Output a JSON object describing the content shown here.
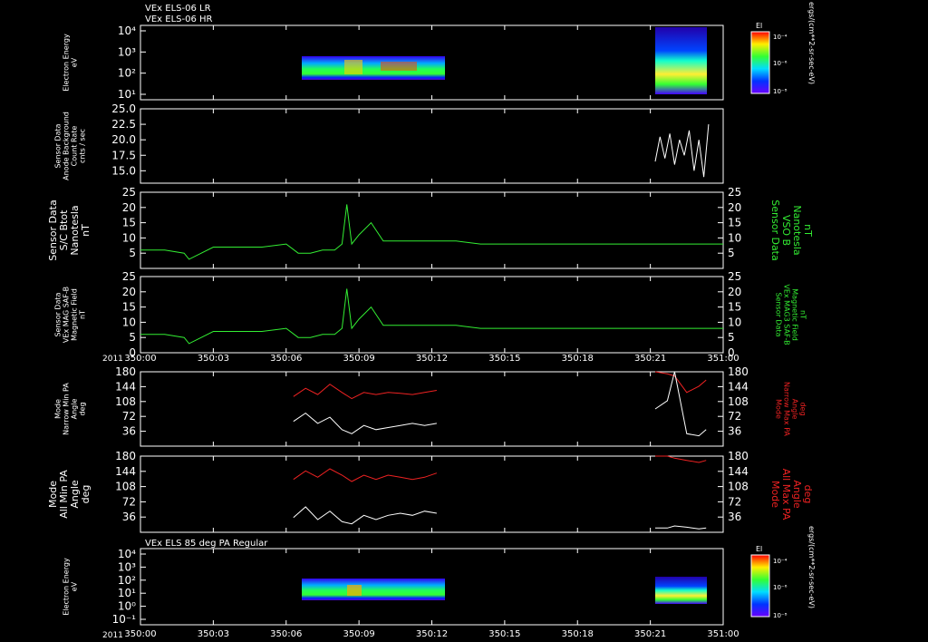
{
  "header": {
    "line1": "VEx ELS-06 LR",
    "line2": "VEx ELS-06 HR"
  },
  "footer_year": "2011",
  "spectrogram2_title": "VEx ELS 85 deg PA Regular",
  "x_ticks": [
    "350:00",
    "350:03",
    "350:06",
    "350:09",
    "350:12",
    "350:15",
    "350:18",
    "350:21",
    "351:00"
  ],
  "colors": {
    "green": "#33ee33",
    "red": "#ee2222",
    "white": "#ffffff"
  },
  "colorbar": {
    "label": "El",
    "ticks": [
      "10⁻⁴",
      "10⁻⁶",
      "10⁻⁸"
    ],
    "unit": "ergs/(cm**2-sr-sec-eV)"
  },
  "chart_data": [
    {
      "type": "heatmap",
      "id": "p1",
      "ylabel_lines": [
        "Electron Energy",
        "eV"
      ],
      "yticks": [
        "10⁴",
        "10³",
        "10²",
        "10¹"
      ],
      "ylog": true,
      "blocks": [
        {
          "x_start": "350:06.3",
          "x_end": "350:12.3"
        },
        {
          "x_start": "350:21.2",
          "x_end": "350:23.3"
        }
      ]
    },
    {
      "type": "line",
      "id": "p2",
      "ylabel_lines": [
        "Sensor Data",
        "Anode Background",
        "Count Rate",
        "cnts / sec"
      ],
      "yticks": [
        "25.0",
        "22.5",
        "20.0",
        "17.5",
        "15.0"
      ],
      "ylim": [
        13.0,
        25.0
      ],
      "series": [
        {
          "color": "white",
          "x": [
            21.2,
            21.4,
            21.6,
            21.8,
            22.0,
            22.2,
            22.4,
            22.6,
            22.8,
            23.0,
            23.2,
            23.4
          ],
          "y": [
            16.5,
            20.5,
            17.0,
            21.0,
            16.0,
            20.0,
            17.5,
            21.5,
            15.0,
            20.0,
            14.0,
            22.5
          ]
        }
      ]
    },
    {
      "type": "line",
      "id": "p3",
      "ylabel_lines": [
        "Sensor Data",
        "S/C Btot",
        "Nanotesla",
        "nT"
      ],
      "right_label_lines": [
        "Sensor Data",
        "VSO B",
        "Nanotesla",
        "nT"
      ],
      "yticks": [
        "25",
        "20",
        "15",
        "10",
        "5"
      ],
      "ylim": [
        0,
        25
      ],
      "series": [
        {
          "color": "green",
          "x": [
            0,
            1,
            1.8,
            2,
            3,
            4,
            5,
            6,
            6.5,
            7,
            7.5,
            8,
            8.3,
            8.5,
            8.7,
            9,
            9.5,
            10,
            11,
            12,
            13,
            14,
            15,
            16,
            17,
            18,
            19,
            20,
            21,
            22,
            23,
            24
          ],
          "y": [
            6,
            6,
            5,
            3,
            7,
            7,
            7,
            8,
            5,
            5,
            6,
            6,
            8,
            21,
            8,
            11,
            15,
            9,
            9,
            9,
            9,
            8,
            8,
            8,
            8,
            8,
            8,
            8,
            8,
            8,
            8,
            8
          ]
        }
      ]
    },
    {
      "type": "line",
      "id": "p4",
      "ylabel_lines": [
        "Sensor Data",
        "VEx MAG SAF-B",
        "Magnetic Field",
        "nT"
      ],
      "right_label_lines": [
        "Sensor Data",
        "VEx MAG3 SAF-B",
        "Magnetic Field",
        "nT"
      ],
      "yticks": [
        "25",
        "20",
        "15",
        "10",
        "5",
        "0"
      ],
      "ylim": [
        0,
        25
      ],
      "series": [
        {
          "color": "green",
          "x": [
            0,
            1,
            1.8,
            2,
            3,
            4,
            5,
            6,
            6.5,
            7,
            7.5,
            8,
            8.3,
            8.5,
            8.7,
            9,
            9.5,
            10,
            11,
            12,
            13,
            14,
            15,
            16,
            17,
            18,
            19,
            20,
            21,
            22,
            23,
            24
          ],
          "y": [
            6,
            6,
            5,
            3,
            7,
            7,
            7,
            8,
            5,
            5,
            6,
            6,
            8,
            21,
            8,
            11,
            15,
            9,
            9,
            9,
            9,
            8,
            8,
            8,
            8,
            8,
            8,
            8,
            8,
            8,
            8,
            8
          ]
        }
      ]
    },
    {
      "type": "line",
      "id": "p5",
      "ylabel_lines": [
        "Mode",
        "Narrow Min PA",
        "Angle",
        "deg"
      ],
      "right_label_lines": [
        "Mode",
        "Narrow Max PA",
        "Angle",
        "deg"
      ],
      "yticks": [
        "180",
        "144",
        "108",
        "72",
        "36"
      ],
      "ylim": [
        0,
        180
      ],
      "series": [
        {
          "color": "red",
          "x": [
            6.3,
            6.8,
            7.3,
            7.8,
            8.3,
            8.7,
            9.2,
            9.7,
            10.2,
            10.7,
            11.2,
            11.7,
            12.2,
            21.2,
            21.7,
            22.0,
            22.5,
            23.0,
            23.3
          ],
          "y": [
            120,
            140,
            125,
            150,
            130,
            115,
            130,
            125,
            130,
            128,
            125,
            130,
            135,
            180,
            175,
            170,
            130,
            145,
            160
          ]
        },
        {
          "color": "white",
          "x": [
            6.3,
            6.8,
            7.3,
            7.8,
            8.3,
            8.7,
            9.2,
            9.7,
            10.2,
            10.7,
            11.2,
            11.7,
            12.2,
            21.2,
            21.7,
            22.0,
            22.5,
            23.0,
            23.3
          ],
          "y": [
            60,
            80,
            55,
            70,
            40,
            30,
            50,
            40,
            45,
            50,
            55,
            50,
            55,
            90,
            110,
            180,
            30,
            25,
            40
          ]
        }
      ]
    },
    {
      "type": "line",
      "id": "p6",
      "ylabel_lines": [
        "Mode",
        "All Min PA",
        "Angle",
        "deg"
      ],
      "right_label_lines": [
        "Mode",
        "All Max PA",
        "Angle",
        "deg"
      ],
      "yticks": [
        "180",
        "144",
        "108",
        "72",
        "36"
      ],
      "ylim": [
        0,
        180
      ],
      "series": [
        {
          "color": "red",
          "x": [
            6.3,
            6.8,
            7.3,
            7.8,
            8.3,
            8.7,
            9.2,
            9.7,
            10.2,
            10.7,
            11.2,
            11.7,
            12.2,
            21.2,
            21.7,
            22.0,
            22.5,
            23.0,
            23.3
          ],
          "y": [
            125,
            145,
            130,
            150,
            135,
            120,
            135,
            125,
            135,
            130,
            125,
            130,
            140,
            180,
            180,
            175,
            170,
            165,
            170
          ]
        },
        {
          "color": "white",
          "x": [
            6.3,
            6.8,
            7.3,
            7.8,
            8.3,
            8.7,
            9.2,
            9.7,
            10.2,
            10.7,
            11.2,
            11.7,
            12.2,
            21.2,
            21.7,
            22.0,
            22.5,
            23.0,
            23.3
          ],
          "y": [
            35,
            60,
            30,
            50,
            25,
            20,
            40,
            30,
            40,
            45,
            40,
            50,
            45,
            10,
            10,
            15,
            12,
            8,
            10
          ]
        }
      ]
    },
    {
      "type": "heatmap",
      "id": "p7",
      "ylabel_lines": [
        "Electron Energy",
        "eV"
      ],
      "yticks": [
        "10⁴",
        "10³",
        "10²",
        "10¹",
        "10⁰",
        "10⁻¹"
      ],
      "ylog": true,
      "blocks": [
        {
          "x_start": "350:06.3",
          "x_end": "350:12.3"
        },
        {
          "x_start": "350:21.2",
          "x_end": "350:23.3"
        }
      ]
    }
  ]
}
